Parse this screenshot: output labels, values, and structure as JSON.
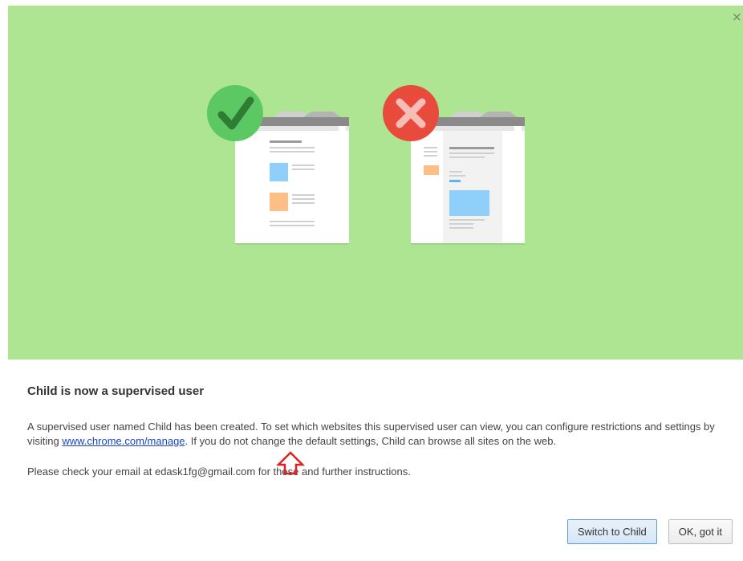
{
  "dialog": {
    "close_glyph": "×",
    "title": "Child is now a supervised user",
    "body_before_link": "A supervised user named Child has been created. To set which websites this supervised user can view, you can configure restrictions and settings by visiting ",
    "link_text": "www.chrome.com/manage",
    "body_after_link": ". If you do not change the default settings, Child can browse all sites on the web.",
    "email_message": "Please check your email at edask1fg@gmail.com for these and further instructions."
  },
  "buttons": {
    "switch_label": "Switch to Child",
    "ok_label": "OK, got it"
  },
  "illustration": {
    "allowed_icon": "checkmark-icon",
    "blocked_icon": "x-mark-icon"
  },
  "colors": {
    "hero_background": "#aee592",
    "check_circle": "#5cc863",
    "check_mark": "#2e7d32",
    "x_circle": "#e84a3c",
    "link": "#1a44c2",
    "annotation_arrow": "#e02020",
    "primary_button_border": "#5b9bd5"
  }
}
